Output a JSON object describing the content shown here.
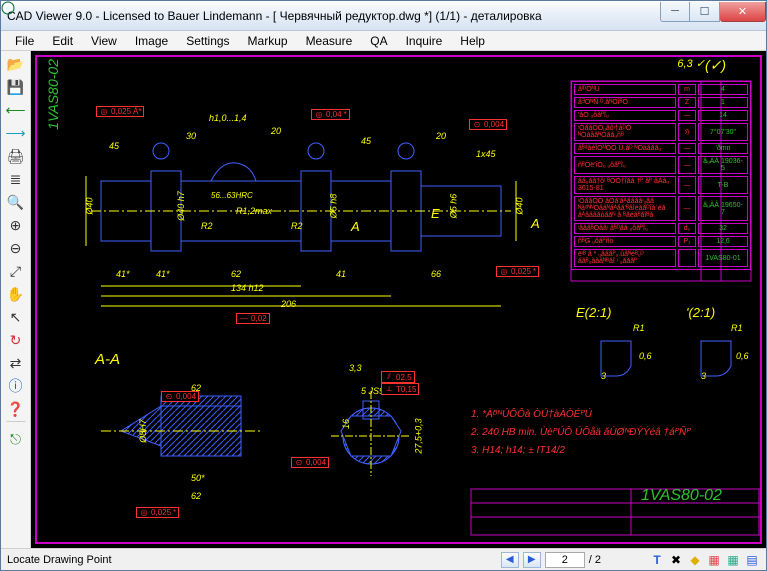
{
  "window": {
    "title": "CAD Viewer 9.0 - Licensed to Bauer Lindemann  -  [ Червячный редуктор.dwg *] (1/1)  -  деталировка"
  },
  "menu": [
    "File",
    "Edit",
    "View",
    "Image",
    "Settings",
    "Markup",
    "Measure",
    "QA",
    "Inquire",
    "Help"
  ],
  "toolbar": [
    {
      "name": "open-icon",
      "glyph": "📂"
    },
    {
      "name": "save-icon",
      "glyph": "💾"
    },
    {
      "name": "back-icon",
      "glyph": "⟵"
    },
    {
      "name": "forward-icon",
      "glyph": "⟶"
    },
    {
      "name": "print-icon",
      "glyph": "🖨"
    },
    {
      "name": "layers-icon",
      "glyph": "≣"
    },
    {
      "name": "zoom-icon",
      "glyph": "🔍"
    },
    {
      "name": "zoom-in-icon",
      "glyph": "⊕"
    },
    {
      "name": "zoom-out-icon",
      "glyph": "⊖"
    },
    {
      "name": "extents-icon",
      "glyph": "⤢"
    },
    {
      "name": "pan-icon",
      "glyph": "✋"
    },
    {
      "name": "pick-icon",
      "glyph": "↖"
    },
    {
      "name": "rotate-icon",
      "glyph": "↻"
    },
    {
      "name": "compare-icon",
      "glyph": "⇄"
    },
    {
      "name": "info-icon",
      "glyph": "ⓘ"
    },
    {
      "name": "help-icon",
      "glyph": "❓"
    },
    {
      "name": "sep",
      "glyph": ""
    },
    {
      "name": "exit-icon",
      "glyph": "⎋"
    }
  ],
  "drawing": {
    "part_no_vert": "1VAS80-02",
    "section_aa": "A-A",
    "detail_e": "E(2:1)",
    "detail_other": "'(2:1)",
    "dims": {
      "d1": "Ø40",
      "d2": "Ø40 h7",
      "d3": "Ø5 h8",
      "d4": "Ø5 h6",
      "d5": "Ø40",
      "l1": "41*",
      "l2": "41*",
      "l3": "62",
      "l4": "41",
      "l5": "66",
      "l6": "134 h12",
      "l7": "206",
      "a1": "45",
      "a2": "30",
      "a3": "20",
      "a4": "45",
      "a5": "20",
      "r1": "R1,2max",
      "r2": "R2",
      "r3": "R2",
      "r4": "R1",
      "r5": "R1",
      "f1": "1x45",
      "t1": "h1,0...1,4",
      "t2": "56...63HRC",
      "t3": "0,6",
      "t4": "0,6",
      "sec_w": "62",
      "sec_h": "50*",
      "sec_d": "Ø8H7",
      "sec_h2": "62",
      "key_w": "5 JS9",
      "key_h": "16",
      "key_d": "27,5+0,3",
      "key_t": "3,3",
      "det_e_w": "3",
      "det_o_w": "3"
    },
    "tol": {
      "g1": "0,025",
      "g2": "0,04",
      "g3": "0,004",
      "g4": "0,025",
      "g5": "0,004",
      "g6": "0,025",
      "g7": "0,004",
      "g8": "0,02",
      "g9": "02,5",
      "g10": "T0,15"
    },
    "surface": "6,3",
    "notes": [
      "1. *ÀᴮᴺÚÔÔà ÒÚ†àÀÒÉᴾÚ",
      "2. 240 HB min. ÙèᴾÚÔ ÚÔåä ǎÙØᴺÐÝÝéâ †áᴾÑᴾ",
      "3. H14; h14;  ±  IT14/2"
    ],
    "table_rows": [
      [
        "ǎᴵᴰÒᴺÚ",
        "m",
        "4"
      ],
      [
        "ǎᴲÓᴺÑ ᴰ.ǎᴺÒîᴮÓ",
        "Z",
        "1"
      ],
      [
        "'ǎÒ ᵤôǎᴾîᵤ",
        "—",
        "14"
      ],
      [
        "ᶦÒǎǎÒÒᵤǎôᶦ†åᴰÓ\nᴺÒáåǎᴺÒǎǎᵤñᴮ",
        "ℌ",
        "7°07'30\""
      ],
      [
        "ǎᴮᵈǎéîÒᴺ᷾ÒÒ Ú.ǎᴰ ᴺÒáǎǎǎᵤ",
        "—",
        "'ðmn"
      ],
      [
        "ñᴮÒë'îÒᵤ ᵤôǎᴾîᵤ",
        "—",
        "ǎᵤÀÀ 19036-5"
      ],
      [
        "ǎǎᵤǎǎ†ôᶦ ᴮÓÒ†îǎǎ\n†ᴾ ǎᴾ ǎÀǎᵤ 3615-81",
        "—",
        "T-B"
      ],
      [
        "ᶦÒǎǎÒÒ ǎÒǎ'ǎᴬǎǎǎǎᶦᵤǎǎ\nᴺǎᵈᴺᴺÒǎǎᴺǎᴬǎǎ'ᴮǎîëǎǎᴰîǎʿéǎ\nǎᴬǎǎǎǎòǎǎᴺ ǎ ᴮǎéǎᴮǎîᴮǎ",
        "—",
        "ǎᵤÀÀ 19650-7"
      ],
      [
        "ᶦǎǎǎᴮÒǎǎᶦ ǎᴮᴰǎǎ ᵤôǎᴾîᵤ",
        "d₂",
        "32"
      ],
      [
        "ñᴮǤ ᵤôǎᴾño",
        "P₁",
        "12,6"
      ],
      [
        "ëᶦᴮ ǎ * ᵤǎǎǎᴾᵤ.ǚǎᴺéᴮᵤᴰ\nǎǎᴮᵤǎǎǎᴺᴮǎî ᶦ ᵤǎǎǎᴾ",
        "",
        "1VAS80-01"
      ]
    ],
    "titleblock": "1VAS80-02"
  },
  "status": {
    "msg": "Locate Drawing Point",
    "page_current": "2",
    "page_total": "/ 2"
  }
}
